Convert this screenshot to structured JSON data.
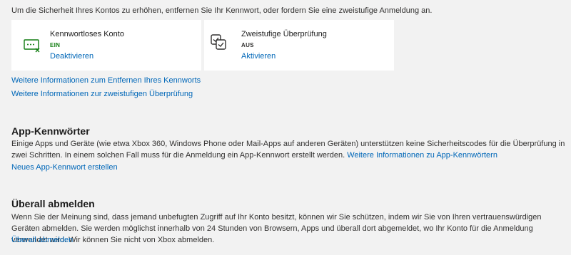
{
  "intro_text": "Um die Sicherheit Ihres Kontos zu erhöhen, entfernen Sie Ihr Kennwort, oder fordern Sie eine zweistufige Anmeldung an.",
  "cards": [
    {
      "title": "Kennwortloses Konto",
      "state": "EIN",
      "action": "Deaktivieren",
      "icon": "passwordless-icon",
      "state_color": "#107c10"
    },
    {
      "title": "Zweistufige Überprüfung",
      "state": "AUS",
      "action": "Aktivieren",
      "icon": "two-step-verification-icon",
      "state_color": "#323130"
    }
  ],
  "links": {
    "remove_password_info": "Weitere Informationen zum Entfernen Ihres Kennworts",
    "two_step_info": "Weitere Informationen zur zweistufigen Überprüfung"
  },
  "app_passwords": {
    "heading": "App-Kennwörter",
    "description": "Einige Apps und Geräte (wie etwa Xbox 360, Windows Phone oder Mail-Apps auf anderen Geräten) unterstützen keine Sicherheitscodes für die Überprüfung in zwei Schritten. In einem solchen Fall muss für die Anmeldung ein App-Kennwort erstellt werden.",
    "info_link": "Weitere Informationen zu App-Kennwörtern",
    "create_link": "Neues App-Kennwort erstellen"
  },
  "sign_out_everywhere": {
    "heading": "Überall abmelden",
    "description": "Wenn Sie der Meinung sind, dass jemand unbefugten Zugriff auf Ihr Konto besitzt, können wir Sie schützen, indem wir Sie von Ihren vertrauenswürdigen Geräten abmelden. Sie werden möglichst innerhalb von 24 Stunden von Browsern, Apps und überall dort abgemeldet, wo Ihr Konto für die Anmeldung verwendet wird. Wir können Sie nicht von Xbox abmelden.",
    "action_link": "Überall abmelden"
  },
  "colors": {
    "link": "#0067b8",
    "background": "#f2f2f2",
    "card": "#ffffff",
    "on": "#107c10"
  }
}
